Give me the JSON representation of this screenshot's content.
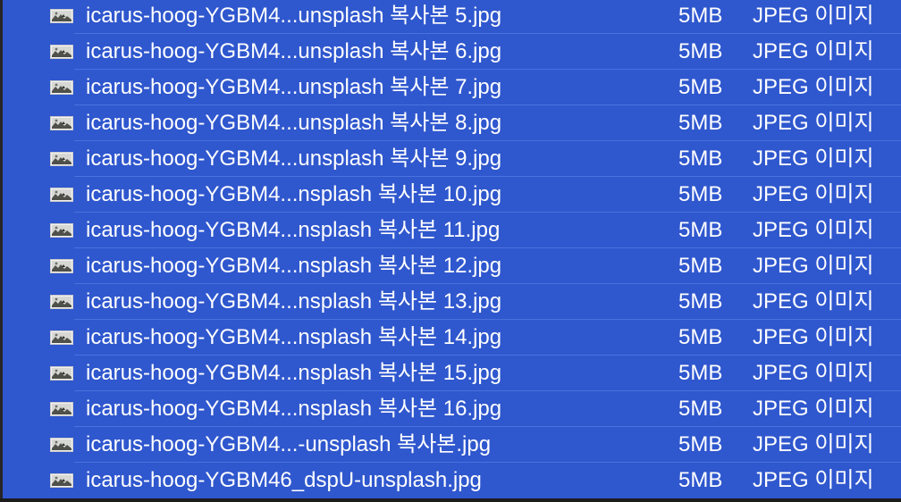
{
  "file_list": {
    "rows": [
      {
        "name": "icarus-hoog-YGBM4...unsplash 복사본 5.jpg",
        "size": "5MB",
        "kind": "JPEG 이미지",
        "icon": "image-thumbnail-icon"
      },
      {
        "name": "icarus-hoog-YGBM4...unsplash 복사본 6.jpg",
        "size": "5MB",
        "kind": "JPEG 이미지",
        "icon": "image-thumbnail-icon"
      },
      {
        "name": "icarus-hoog-YGBM4...unsplash 복사본 7.jpg",
        "size": "5MB",
        "kind": "JPEG 이미지",
        "icon": "image-thumbnail-icon"
      },
      {
        "name": "icarus-hoog-YGBM4...unsplash 복사본 8.jpg",
        "size": "5MB",
        "kind": "JPEG 이미지",
        "icon": "image-thumbnail-icon"
      },
      {
        "name": "icarus-hoog-YGBM4...unsplash 복사본 9.jpg",
        "size": "5MB",
        "kind": "JPEG 이미지",
        "icon": "image-thumbnail-icon"
      },
      {
        "name": "icarus-hoog-YGBM4...nsplash 복사본 10.jpg",
        "size": "5MB",
        "kind": "JPEG 이미지",
        "icon": "image-thumbnail-icon"
      },
      {
        "name": "icarus-hoog-YGBM4...nsplash 복사본 11.jpg",
        "size": "5MB",
        "kind": "JPEG 이미지",
        "icon": "image-thumbnail-icon"
      },
      {
        "name": "icarus-hoog-YGBM4...nsplash 복사본 12.jpg",
        "size": "5MB",
        "kind": "JPEG 이미지",
        "icon": "image-thumbnail-icon"
      },
      {
        "name": "icarus-hoog-YGBM4...nsplash 복사본 13.jpg",
        "size": "5MB",
        "kind": "JPEG 이미지",
        "icon": "image-thumbnail-icon"
      },
      {
        "name": "icarus-hoog-YGBM4...nsplash 복사본 14.jpg",
        "size": "5MB",
        "kind": "JPEG 이미지",
        "icon": "image-thumbnail-icon"
      },
      {
        "name": "icarus-hoog-YGBM4...nsplash 복사본 15.jpg",
        "size": "5MB",
        "kind": "JPEG 이미지",
        "icon": "image-thumbnail-icon"
      },
      {
        "name": "icarus-hoog-YGBM4...nsplash 복사본 16.jpg",
        "size": "5MB",
        "kind": "JPEG 이미지",
        "icon": "image-thumbnail-icon"
      },
      {
        "name": "icarus-hoog-YGBM4...-unsplash 복사본.jpg",
        "size": "5MB",
        "kind": "JPEG 이미지",
        "icon": "image-thumbnail-icon"
      },
      {
        "name": "icarus-hoog-YGBM46_dspU-unsplash.jpg",
        "size": "5MB",
        "kind": "JPEG 이미지",
        "icon": "image-thumbnail-icon"
      }
    ]
  },
  "colors": {
    "selection": "#2f57ce",
    "selection_divider": "#4a73de",
    "text": "#ffffff",
    "chrome": "#1e1e1e"
  }
}
